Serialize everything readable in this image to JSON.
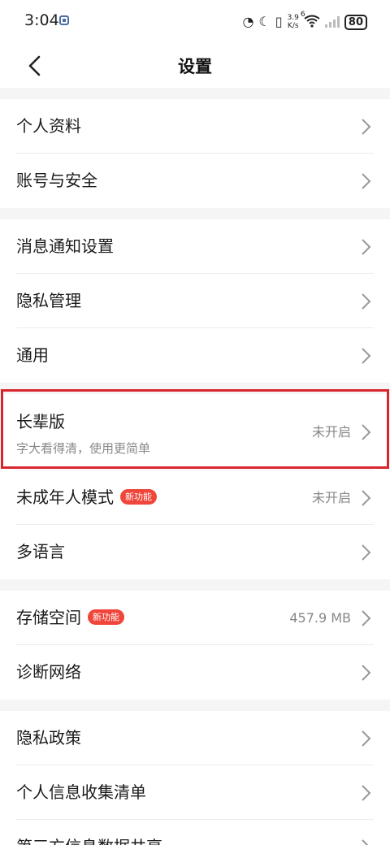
{
  "status_bar": {
    "time": "3:04",
    "network_speed_value": "3.9",
    "network_speed_unit": "K/s",
    "wifi_label": "6",
    "battery": "80",
    "icons": [
      "app-notification-icon",
      "data-saver-icon",
      "moon-icon",
      "vibrate-icon",
      "wifi-icon",
      "signal-icon",
      "battery-icon"
    ]
  },
  "header": {
    "title": "设置",
    "back_icon": "chevron-left-icon"
  },
  "groups": {
    "g1": {
      "profile": {
        "label": "个人资料"
      },
      "account": {
        "label": "账号与安全"
      }
    },
    "g2": {
      "notify": {
        "label": "消息通知设置"
      },
      "privacy": {
        "label": "隐私管理"
      },
      "general": {
        "label": "通用"
      }
    },
    "g3": {
      "elder": {
        "label": "长辈版",
        "sub": "字大看得清，使用更简单",
        "value": "未开启"
      },
      "minor": {
        "label": "未成年人模式",
        "badge": "新功能",
        "value": "未开启"
      },
      "lang": {
        "label": "多语言"
      }
    },
    "g4": {
      "storage": {
        "label": "存储空间",
        "badge": "新功能",
        "value": "457.9 MB"
      },
      "diag": {
        "label": "诊断网络"
      }
    },
    "g5": {
      "policy": {
        "label": "隐私政策"
      },
      "collect": {
        "label": "个人信息收集清单"
      },
      "third": {
        "label": "第三方信息数据共享"
      }
    }
  },
  "colors": {
    "accent_red": "#d9262e",
    "badge": "#f0453a",
    "divider_band": "#f5f5f5"
  }
}
